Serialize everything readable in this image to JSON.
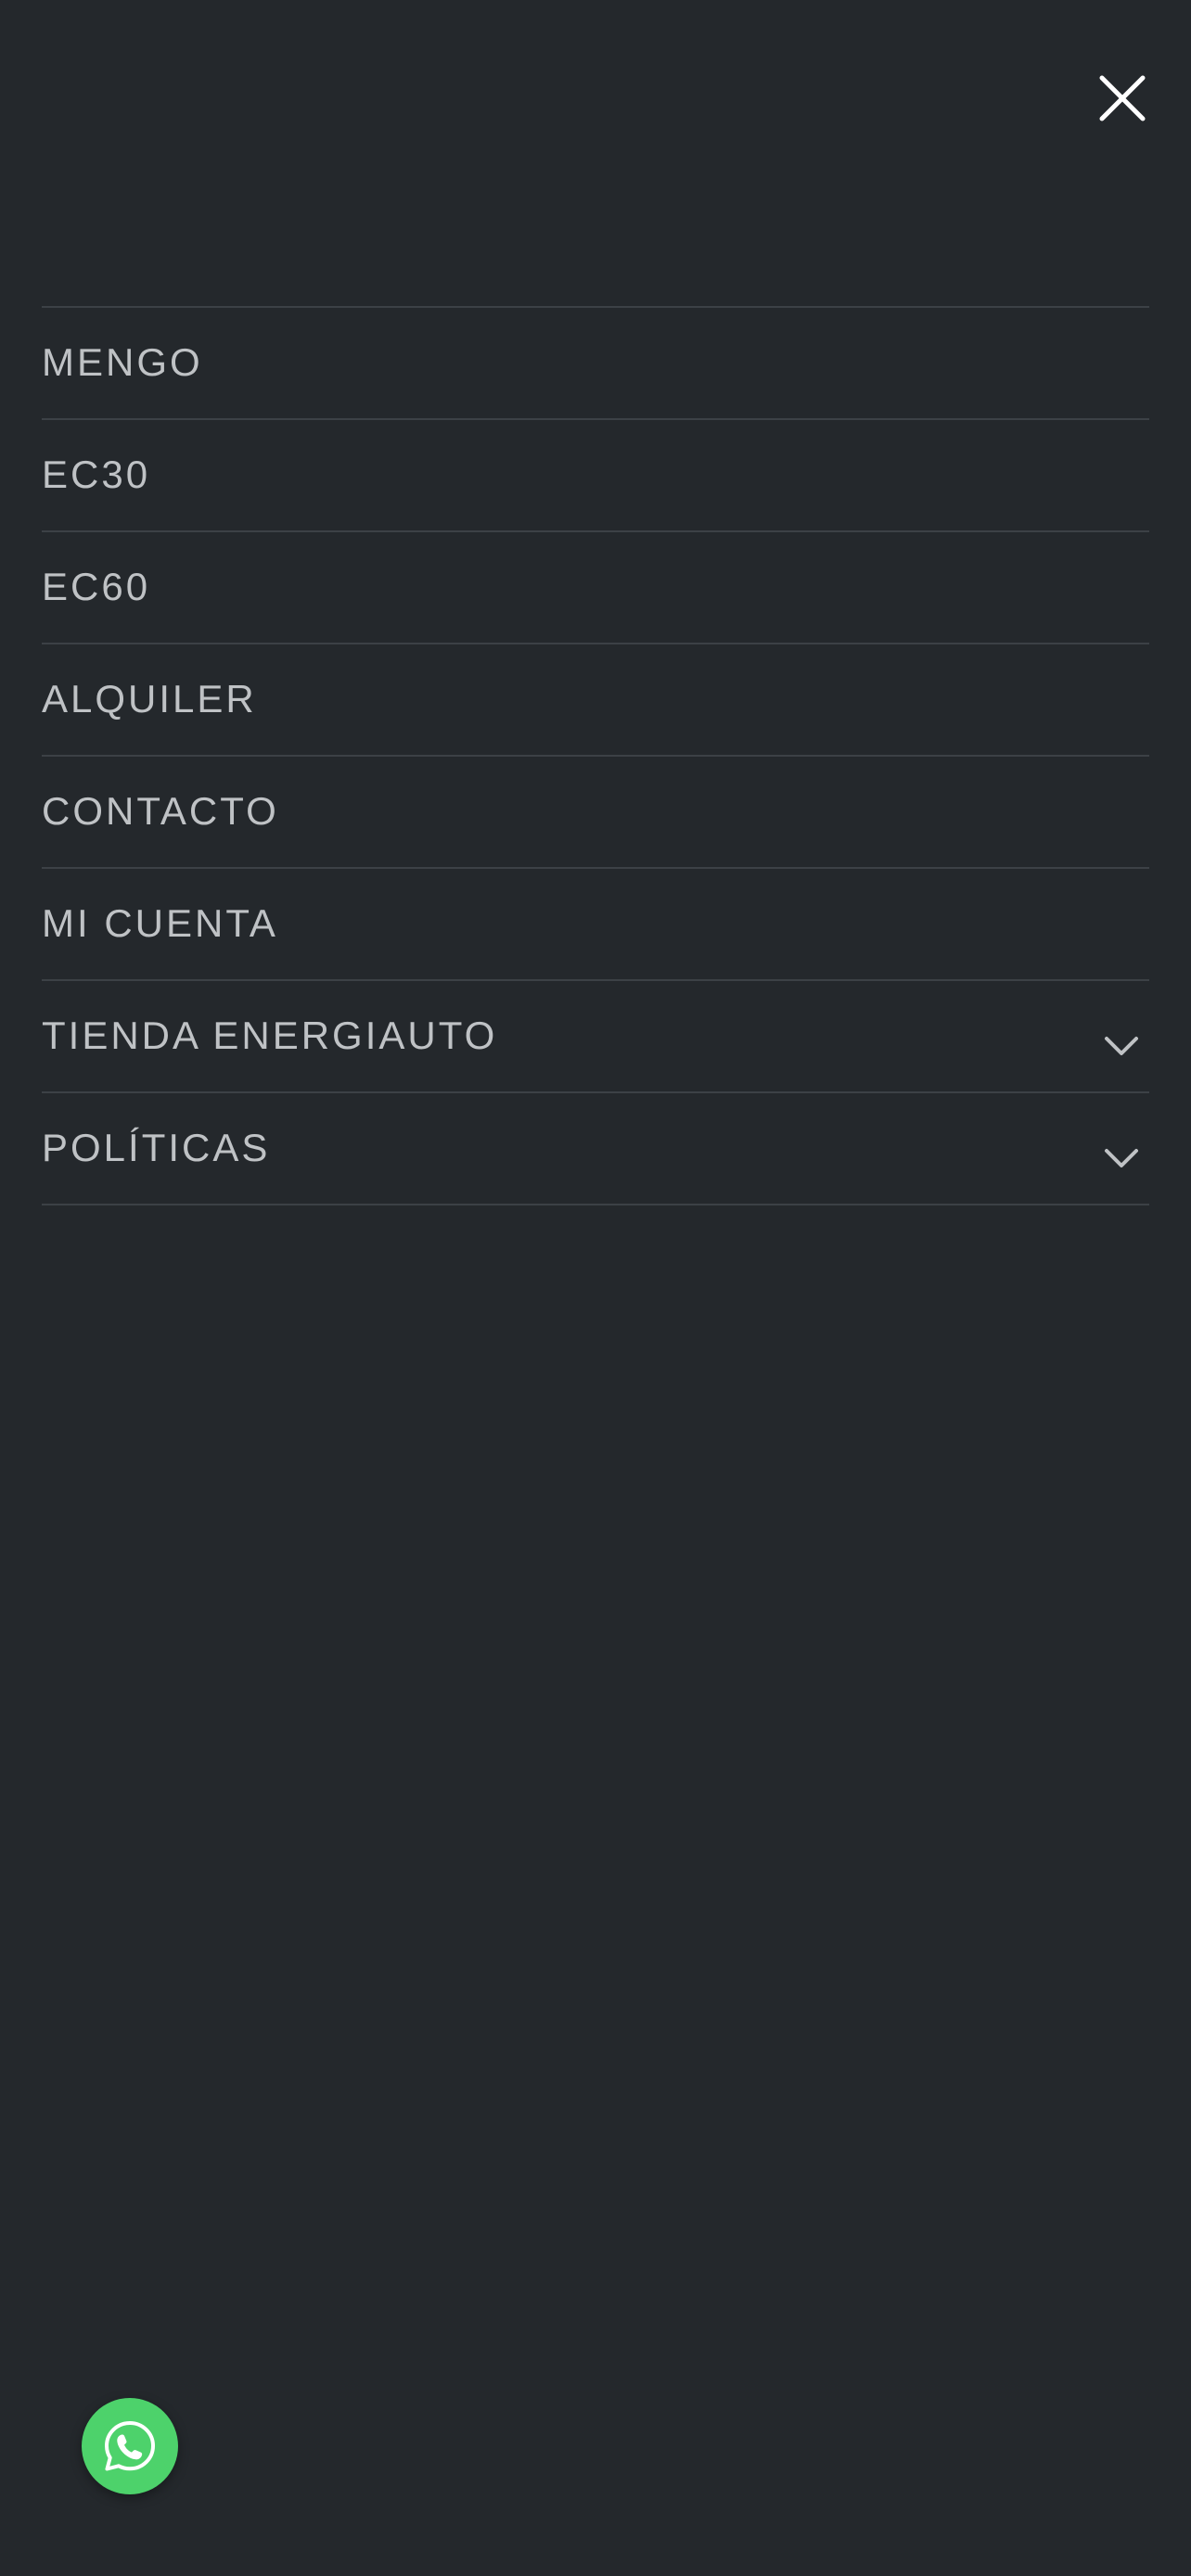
{
  "header": {
    "close_icon": "close-icon"
  },
  "menu": {
    "items": [
      {
        "label": "MENGO",
        "has_submenu": false
      },
      {
        "label": "EC30",
        "has_submenu": false
      },
      {
        "label": "EC60",
        "has_submenu": false
      },
      {
        "label": "ALQUILER",
        "has_submenu": false
      },
      {
        "label": "CONTACTO",
        "has_submenu": false
      },
      {
        "label": "MI CUENTA",
        "has_submenu": false
      },
      {
        "label": "TIENDA ENERGIAUTO",
        "has_submenu": true,
        "icon": "chevron-down-icon"
      },
      {
        "label": "POLÍTICAS",
        "has_submenu": true,
        "icon": "chevron-down-icon"
      }
    ]
  },
  "floating": {
    "whatsapp_icon": "whatsapp-icon"
  },
  "colors": {
    "background": "#24282c",
    "text": "#bfc2c5",
    "divider": "#3c4146",
    "whatsapp": "#4dd26b"
  }
}
